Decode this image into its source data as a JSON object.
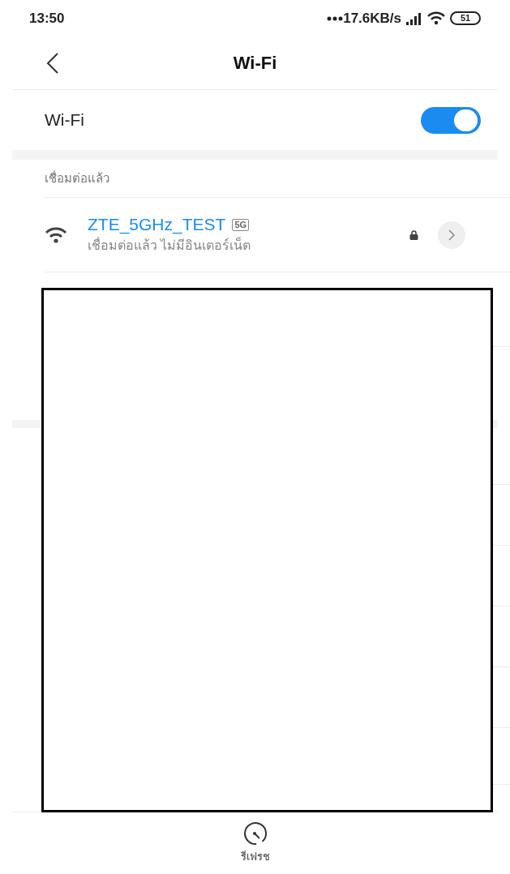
{
  "status_bar": {
    "time": "13:50",
    "speed": "17.6KB/s",
    "battery": "51"
  },
  "header": {
    "title": "Wi-Fi"
  },
  "wifi_toggle": {
    "label": "Wi-Fi",
    "on": true
  },
  "connected_section": {
    "label": "เชื่อมต่อแล้ว",
    "networks": [
      {
        "name": "ZTE_5GHz_TEST",
        "band": "5G",
        "status": "เชื่อมต่อแล้ว ไม่มีอินเตอร์เน็ต",
        "locked": true
      }
    ]
  },
  "bottom_action": {
    "label": "รีเฟรช"
  }
}
